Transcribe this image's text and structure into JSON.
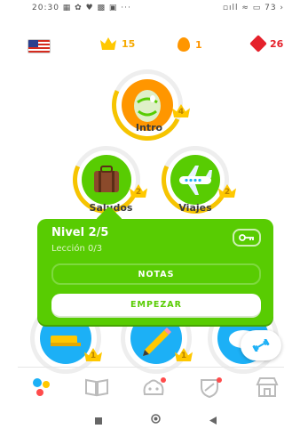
{
  "status_bar": {
    "time": "20:30 ▦ ✿ ♥ ▩ ▣ ···",
    "right": "▫ıll ≈ ▭ 73 ›"
  },
  "stats": {
    "crowns": "15",
    "streak": "1",
    "gems": "26"
  },
  "skills": [
    {
      "label": "Intro",
      "crown_level": "4",
      "color": "#ff9600"
    },
    {
      "label": "Saludos",
      "crown_level": "2",
      "color": "#58cc02"
    },
    {
      "label": "Viajes",
      "crown_level": "2",
      "color": "#58cc02"
    },
    {
      "label": "",
      "crown_level": "1",
      "color": "#1cb0f6"
    },
    {
      "label": "",
      "crown_level": "1",
      "color": "#1cb0f6"
    },
    {
      "label": "",
      "crown_level": "",
      "color": "#1cb0f6"
    }
  ],
  "popup": {
    "title": "Nivel 2/5",
    "subtitle": "Lección 0/3",
    "notes_button": "NOTAS",
    "start_button": "EMPEZAR"
  },
  "nav": {
    "items": [
      "learn-icon",
      "stories-icon",
      "profile-icon",
      "leagues-icon",
      "shop-icon"
    ]
  },
  "system_nav": [
    "recents-button",
    "home-button",
    "back-button"
  ],
  "colors": {
    "green": "#58cc02",
    "orange": "#ff9600",
    "blue": "#1cb0f6",
    "gold": "#ffc800",
    "red": "#e5212b"
  }
}
